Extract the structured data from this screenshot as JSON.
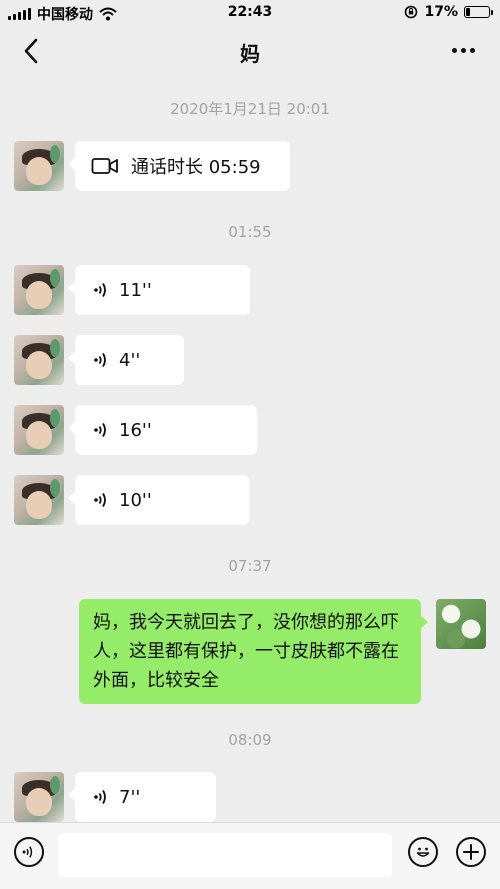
{
  "status_bar": {
    "carrier": "中国移动",
    "time": "22:43",
    "battery_percent": "17%",
    "battery_level": 0.17,
    "icons": [
      "signal-icon",
      "wifi-icon",
      "rotation-lock-icon",
      "battery-icon"
    ]
  },
  "nav": {
    "title": "妈",
    "back_icon": "chevron-left-icon",
    "more_icon": "ellipsis-icon"
  },
  "messages": {
    "ts1": "2020年1月21日 20:01",
    "call_text": "通话时长 05:59",
    "ts2": "01:55",
    "voice1": "11''",
    "voice2": "4''",
    "voice3": "16''",
    "voice4": "10''",
    "ts3": "07:37",
    "self_msg": "妈，我今天就回去了，没你想的那么吓人，这里都有保护，一寸皮肤都不露在外面，比较安全",
    "ts4": "08:09",
    "voice5": "7''"
  },
  "input_bar": {
    "voice_icon": "voice-input-icon",
    "emoji_icon": "emoji-icon",
    "plus_icon": "plus-icon",
    "placeholder": ""
  },
  "colors": {
    "background": "#ededed",
    "self_bubble": "#95ec69",
    "other_bubble": "#ffffff",
    "timestamp": "#a3a3a3"
  }
}
